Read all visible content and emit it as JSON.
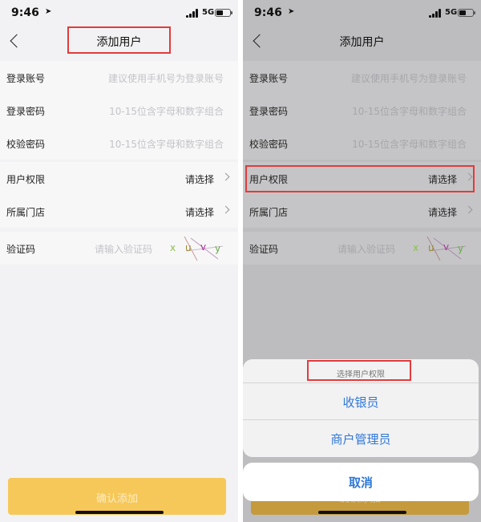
{
  "status_bar": {
    "time": "9:46",
    "network": "5G"
  },
  "page_title": "添加用户",
  "form": {
    "fields": [
      {
        "label": "登录账号",
        "placeholder": "建议使用手机号为登录账号"
      },
      {
        "label": "登录密码",
        "placeholder": "10-15位含字母和数字组合"
      },
      {
        "label": "校验密码",
        "placeholder": "10-15位含字母和数字组合"
      }
    ],
    "selects": [
      {
        "label": "用户权限",
        "value": "请选择"
      },
      {
        "label": "所属门店",
        "value": "请选择"
      }
    ],
    "captcha": {
      "label": "验证码",
      "placeholder": "请输入验证码",
      "chars": [
        "x",
        "u",
        "v",
        "y"
      ]
    }
  },
  "confirm_button": "确认添加",
  "action_sheet": {
    "title": "选择用户权限",
    "options": [
      "收银员",
      "商户管理员"
    ],
    "cancel": "取消"
  },
  "colors": {
    "accent": "#f6c85a",
    "highlight": "#e23b3b",
    "ios_blue": "#2f77d8"
  }
}
